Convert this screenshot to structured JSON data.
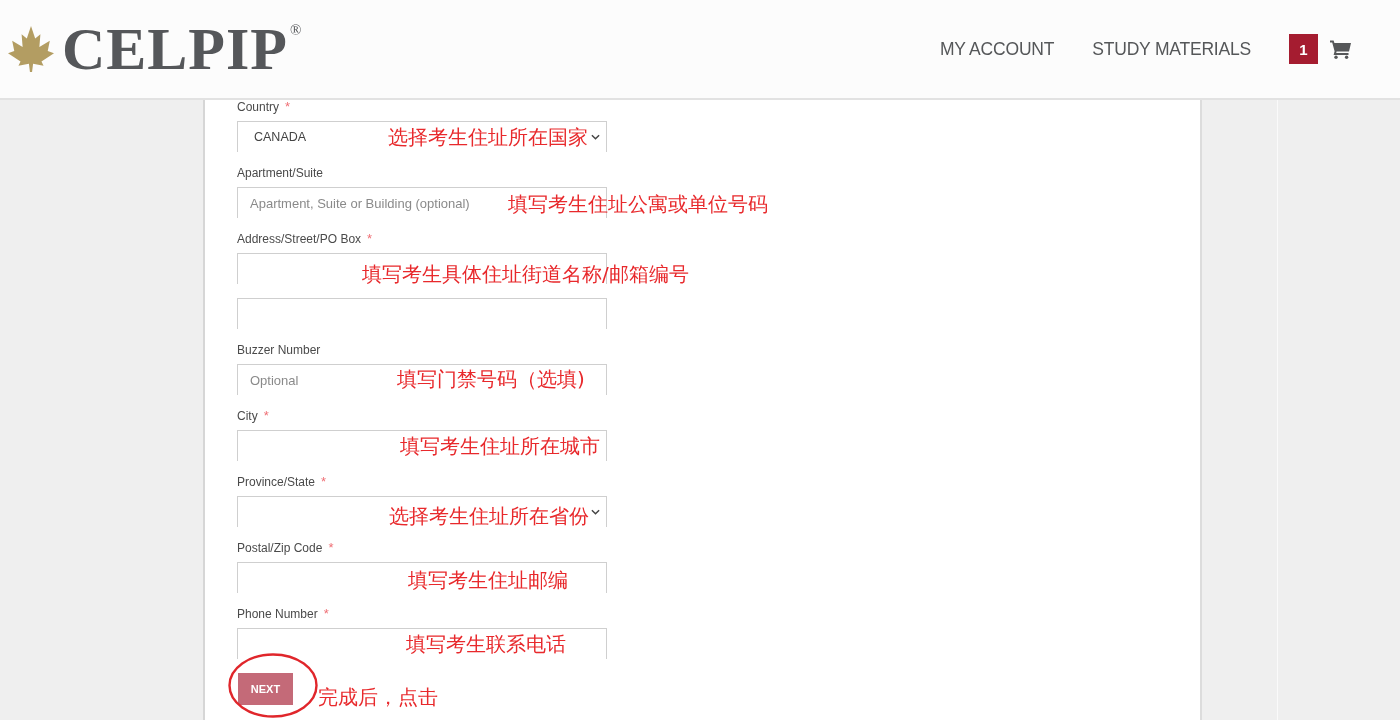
{
  "header": {
    "logo": {
      "wordmark": "CELPIP$^{®}$"
    },
    "nav": [
      "MY ACCOUNT",
      "STUDY MATERIALS"
    ],
    "cart": {
      "count": "1"
    }
  },
  "form": {
    "fields": [
      {
        "kind": "select",
        "label": "Country",
        "required_mark": "*",
        "value": "CANADA",
        "annotation": "选择考生住址所在国家"
      },
      {
        "kind": "text",
        "label": "Apartment/Suite",
        "placeholder": "Apartment, Suite or Building (optional)",
        "annotation": "填写考生住址公寓或单位号码"
      },
      {
        "kind": "text",
        "label": "Address/Street/PO Box",
        "required_mark": "*",
        "annotation": "填写考生具体住址街道名称/邮箱编号"
      },
      {
        "kind": "text"
      },
      {
        "kind": "text",
        "label": "Buzzer Number",
        "placeholder": "Optional",
        "annotation": "填写门禁号码（选填)"
      },
      {
        "kind": "text",
        "label": "City",
        "required_mark": "*",
        "annotation": "填写考生住址所在城市"
      },
      {
        "kind": "select",
        "label": "Province/State",
        "required_mark": "*",
        "annotation": "选择考生住址所在省份"
      },
      {
        "kind": "text",
        "label": "Postal/Zip Code",
        "required_mark": "*",
        "annotation": "填写考生住址邮编"
      },
      {
        "kind": "text",
        "label": "Phone Number",
        "required_mark": "*",
        "annotation": "填写考生联系电话"
      }
    ],
    "button": {
      "label": "NEXT",
      "annotation": "完成后，点击"
    }
  }
}
